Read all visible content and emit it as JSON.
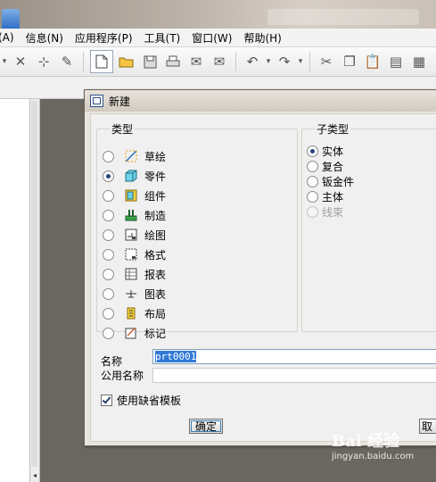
{
  "menu": [
    "(A)",
    "信息(N)",
    "应用程序(P)",
    "工具(T)",
    "窗口(W)",
    "帮助(H)"
  ],
  "dialog": {
    "title": "新建",
    "type_legend": "类型",
    "types": [
      {
        "label": "草绘",
        "icon": "sketch-icon",
        "selected": false
      },
      {
        "label": "零件",
        "icon": "part-icon",
        "selected": true
      },
      {
        "label": "组件",
        "icon": "assembly-icon",
        "selected": false
      },
      {
        "label": "制造",
        "icon": "manufacturing-icon",
        "selected": false
      },
      {
        "label": "绘图",
        "icon": "drawing-icon",
        "selected": false
      },
      {
        "label": "格式",
        "icon": "format-icon",
        "selected": false
      },
      {
        "label": "报表",
        "icon": "report-icon",
        "selected": false
      },
      {
        "label": "图表",
        "icon": "diagram-icon",
        "selected": false
      },
      {
        "label": "布局",
        "icon": "layout-icon",
        "selected": false
      },
      {
        "label": "标记",
        "icon": "markup-icon",
        "selected": false
      }
    ],
    "subtype_legend": "子类型",
    "subtypes": [
      {
        "label": "实体",
        "selected": true,
        "disabled": false
      },
      {
        "label": "复合",
        "selected": false,
        "disabled": false
      },
      {
        "label": "钣金件",
        "selected": false,
        "disabled": false
      },
      {
        "label": "主体",
        "selected": false,
        "disabled": false
      },
      {
        "label": "线束",
        "selected": false,
        "disabled": true
      }
    ],
    "name_label": "名称",
    "name_value": "prt0001",
    "common_name_label": "公用名称",
    "common_name_value": "",
    "use_default_template_label": "使用缺省模板",
    "use_default_template_checked": true,
    "ok_label": "确定",
    "cancel_label": "取"
  },
  "watermark": {
    "text": "Bai 经验",
    "url": "jingyan.baidu.com"
  }
}
